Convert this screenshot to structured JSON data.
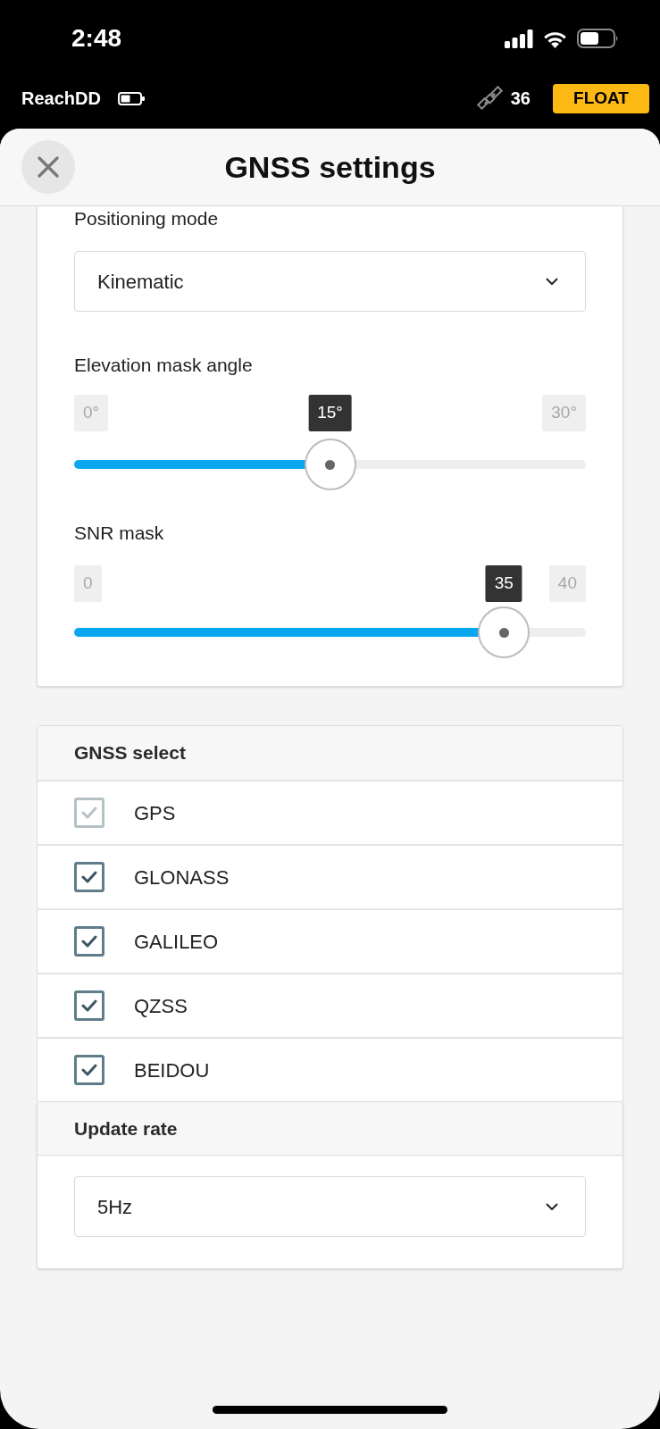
{
  "status_bar": {
    "time": "2:48"
  },
  "device_bar": {
    "device_name": "ReachDD",
    "satellites": "36",
    "solution_status": "FLOAT"
  },
  "header": {
    "title": "GNSS settings"
  },
  "positioning_mode": {
    "label": "Positioning mode",
    "value": "Kinematic"
  },
  "sliders": [
    {
      "label": "Elevation mask angle",
      "min": "0°",
      "max": "30°",
      "value": "15°",
      "level": 0.5
    },
    {
      "label": "SNR mask",
      "min": "0",
      "max": "40",
      "value": "35",
      "level": 0.84
    }
  ],
  "gnss_select": {
    "title": "GNSS select",
    "items": [
      {
        "label": "GPS",
        "checked": true,
        "disabled": true
      },
      {
        "label": "GLONASS",
        "checked": true,
        "disabled": false
      },
      {
        "label": "GALILEO",
        "checked": true,
        "disabled": false
      },
      {
        "label": "QZSS",
        "checked": true,
        "disabled": false
      },
      {
        "label": "BEIDOU",
        "checked": true,
        "disabled": false
      }
    ]
  },
  "update_rate": {
    "title": "Update rate",
    "value": "5Hz"
  }
}
